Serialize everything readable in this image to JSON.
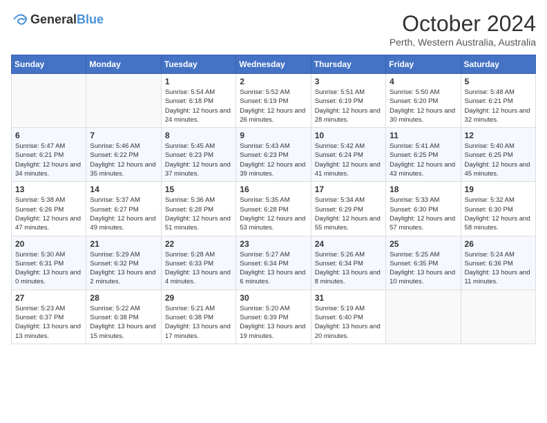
{
  "header": {
    "logo_general": "General",
    "logo_blue": "Blue",
    "month_title": "October 2024",
    "location": "Perth, Western Australia, Australia"
  },
  "days_of_week": [
    "Sunday",
    "Monday",
    "Tuesday",
    "Wednesday",
    "Thursday",
    "Friday",
    "Saturday"
  ],
  "weeks": [
    [
      {
        "day": "",
        "info": ""
      },
      {
        "day": "",
        "info": ""
      },
      {
        "day": "1",
        "info": "Sunrise: 5:54 AM\nSunset: 6:18 PM\nDaylight: 12 hours and 24 minutes."
      },
      {
        "day": "2",
        "info": "Sunrise: 5:52 AM\nSunset: 6:19 PM\nDaylight: 12 hours and 26 minutes."
      },
      {
        "day": "3",
        "info": "Sunrise: 5:51 AM\nSunset: 6:19 PM\nDaylight: 12 hours and 28 minutes."
      },
      {
        "day": "4",
        "info": "Sunrise: 5:50 AM\nSunset: 6:20 PM\nDaylight: 12 hours and 30 minutes."
      },
      {
        "day": "5",
        "info": "Sunrise: 5:48 AM\nSunset: 6:21 PM\nDaylight: 12 hours and 32 minutes."
      }
    ],
    [
      {
        "day": "6",
        "info": "Sunrise: 5:47 AM\nSunset: 6:21 PM\nDaylight: 12 hours and 34 minutes."
      },
      {
        "day": "7",
        "info": "Sunrise: 5:46 AM\nSunset: 6:22 PM\nDaylight: 12 hours and 35 minutes."
      },
      {
        "day": "8",
        "info": "Sunrise: 5:45 AM\nSunset: 6:23 PM\nDaylight: 12 hours and 37 minutes."
      },
      {
        "day": "9",
        "info": "Sunrise: 5:43 AM\nSunset: 6:23 PM\nDaylight: 12 hours and 39 minutes."
      },
      {
        "day": "10",
        "info": "Sunrise: 5:42 AM\nSunset: 6:24 PM\nDaylight: 12 hours and 41 minutes."
      },
      {
        "day": "11",
        "info": "Sunrise: 5:41 AM\nSunset: 6:25 PM\nDaylight: 12 hours and 43 minutes."
      },
      {
        "day": "12",
        "info": "Sunrise: 5:40 AM\nSunset: 6:25 PM\nDaylight: 12 hours and 45 minutes."
      }
    ],
    [
      {
        "day": "13",
        "info": "Sunrise: 5:38 AM\nSunset: 6:26 PM\nDaylight: 12 hours and 47 minutes."
      },
      {
        "day": "14",
        "info": "Sunrise: 5:37 AM\nSunset: 6:27 PM\nDaylight: 12 hours and 49 minutes."
      },
      {
        "day": "15",
        "info": "Sunrise: 5:36 AM\nSunset: 6:28 PM\nDaylight: 12 hours and 51 minutes."
      },
      {
        "day": "16",
        "info": "Sunrise: 5:35 AM\nSunset: 6:28 PM\nDaylight: 12 hours and 53 minutes."
      },
      {
        "day": "17",
        "info": "Sunrise: 5:34 AM\nSunset: 6:29 PM\nDaylight: 12 hours and 55 minutes."
      },
      {
        "day": "18",
        "info": "Sunrise: 5:33 AM\nSunset: 6:30 PM\nDaylight: 12 hours and 57 minutes."
      },
      {
        "day": "19",
        "info": "Sunrise: 5:32 AM\nSunset: 6:30 PM\nDaylight: 12 hours and 58 minutes."
      }
    ],
    [
      {
        "day": "20",
        "info": "Sunrise: 5:30 AM\nSunset: 6:31 PM\nDaylight: 13 hours and 0 minutes."
      },
      {
        "day": "21",
        "info": "Sunrise: 5:29 AM\nSunset: 6:32 PM\nDaylight: 13 hours and 2 minutes."
      },
      {
        "day": "22",
        "info": "Sunrise: 5:28 AM\nSunset: 6:33 PM\nDaylight: 13 hours and 4 minutes."
      },
      {
        "day": "23",
        "info": "Sunrise: 5:27 AM\nSunset: 6:34 PM\nDaylight: 13 hours and 6 minutes."
      },
      {
        "day": "24",
        "info": "Sunrise: 5:26 AM\nSunset: 6:34 PM\nDaylight: 13 hours and 8 minutes."
      },
      {
        "day": "25",
        "info": "Sunrise: 5:25 AM\nSunset: 6:35 PM\nDaylight: 13 hours and 10 minutes."
      },
      {
        "day": "26",
        "info": "Sunrise: 5:24 AM\nSunset: 6:36 PM\nDaylight: 13 hours and 11 minutes."
      }
    ],
    [
      {
        "day": "27",
        "info": "Sunrise: 5:23 AM\nSunset: 6:37 PM\nDaylight: 13 hours and 13 minutes."
      },
      {
        "day": "28",
        "info": "Sunrise: 5:22 AM\nSunset: 6:38 PM\nDaylight: 13 hours and 15 minutes."
      },
      {
        "day": "29",
        "info": "Sunrise: 5:21 AM\nSunset: 6:38 PM\nDaylight: 13 hours and 17 minutes."
      },
      {
        "day": "30",
        "info": "Sunrise: 5:20 AM\nSunset: 6:39 PM\nDaylight: 13 hours and 19 minutes."
      },
      {
        "day": "31",
        "info": "Sunrise: 5:19 AM\nSunset: 6:40 PM\nDaylight: 13 hours and 20 minutes."
      },
      {
        "day": "",
        "info": ""
      },
      {
        "day": "",
        "info": ""
      }
    ]
  ]
}
